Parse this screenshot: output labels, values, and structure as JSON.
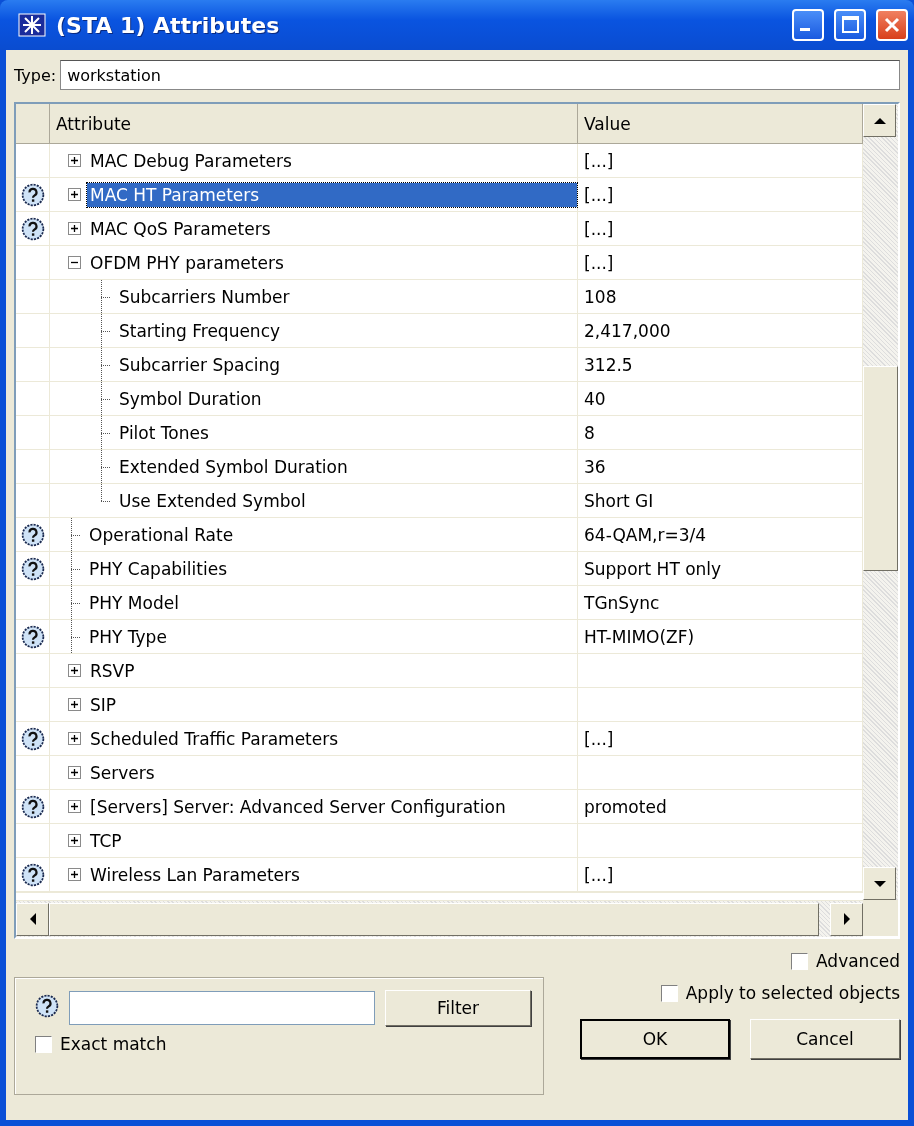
{
  "window": {
    "title": "(STA 1) Attributes"
  },
  "type_field": {
    "label": "Type:",
    "value": "workstation"
  },
  "table": {
    "columns": [
      "Attribute",
      "Value"
    ],
    "rows": [
      {
        "kind": "group",
        "label": "MAC Debug Parameters",
        "value": "[...]",
        "help": false,
        "selected": false,
        "expanded": false
      },
      {
        "kind": "group",
        "label": "MAC HT Parameters",
        "value": "[...]",
        "help": true,
        "selected": true,
        "expanded": false
      },
      {
        "kind": "group",
        "label": "MAC QoS Parameters",
        "value": "[...]",
        "help": true,
        "selected": false,
        "expanded": false
      },
      {
        "kind": "group",
        "label": "OFDM PHY parameters",
        "value": "[...]",
        "help": false,
        "selected": false,
        "expanded": true,
        "children": [
          {
            "kind": "leaf",
            "label": "Subcarriers Number",
            "value": "108",
            "help": false,
            "selected": false
          },
          {
            "kind": "leaf",
            "label": "Starting Frequency",
            "value": "2,417,000",
            "help": false,
            "selected": false
          },
          {
            "kind": "leaf",
            "label": "Subcarrier Spacing",
            "value": "312.5",
            "help": false,
            "selected": false
          },
          {
            "kind": "leaf",
            "label": "Symbol Duration",
            "value": "40",
            "help": false,
            "selected": false
          },
          {
            "kind": "leaf",
            "label": "Pilot Tones",
            "value": "8",
            "help": false,
            "selected": false
          },
          {
            "kind": "leaf",
            "label": "Extended Symbol Duration",
            "value": "36",
            "help": false,
            "selected": false
          },
          {
            "kind": "leaf",
            "label": "Use Extended Symbol",
            "value": "Short GI",
            "help": false,
            "selected": false
          }
        ]
      },
      {
        "kind": "leaf",
        "label": "Operational Rate",
        "value": "64-QAM,r=3/4",
        "help": true,
        "selected": false
      },
      {
        "kind": "leaf",
        "label": "PHY Capabilities",
        "value": "Support HT only",
        "help": true,
        "selected": false
      },
      {
        "kind": "leaf",
        "label": "PHY Model",
        "value": "TGnSync",
        "help": false,
        "selected": false
      },
      {
        "kind": "leaf",
        "label": "PHY Type",
        "value": "HT-MIMO(ZF)",
        "help": true,
        "selected": false
      },
      {
        "kind": "group",
        "label": "RSVP",
        "help": false,
        "selected": false,
        "expanded": false
      },
      {
        "kind": "group",
        "label": "SIP",
        "help": false,
        "selected": false,
        "expanded": false
      },
      {
        "kind": "group",
        "label": "Scheduled Traffic Parameters",
        "value": "[...]",
        "help": true,
        "selected": false,
        "expanded": false
      },
      {
        "kind": "group",
        "label": "Servers",
        "help": false,
        "selected": false,
        "expanded": false
      },
      {
        "kind": "group",
        "label": "[Servers] Server: Advanced Server Configuration",
        "value": "promoted",
        "help": true,
        "selected": false,
        "expanded": false
      },
      {
        "kind": "group",
        "label": "TCP",
        "help": false,
        "selected": false,
        "expanded": false
      },
      {
        "kind": "group",
        "label": "Wireless Lan Parameters",
        "value": "[...]",
        "help": true,
        "selected": false,
        "expanded": false
      }
    ]
  },
  "advanced": {
    "label": "Advanced",
    "checked": false
  },
  "filter": {
    "button": "Filter",
    "exact_match": {
      "label": "Exact match",
      "checked": false
    }
  },
  "apply_to_selected": {
    "label": "Apply to selected objects",
    "checked": false
  },
  "buttons": [
    "OK",
    "Cancel"
  ]
}
